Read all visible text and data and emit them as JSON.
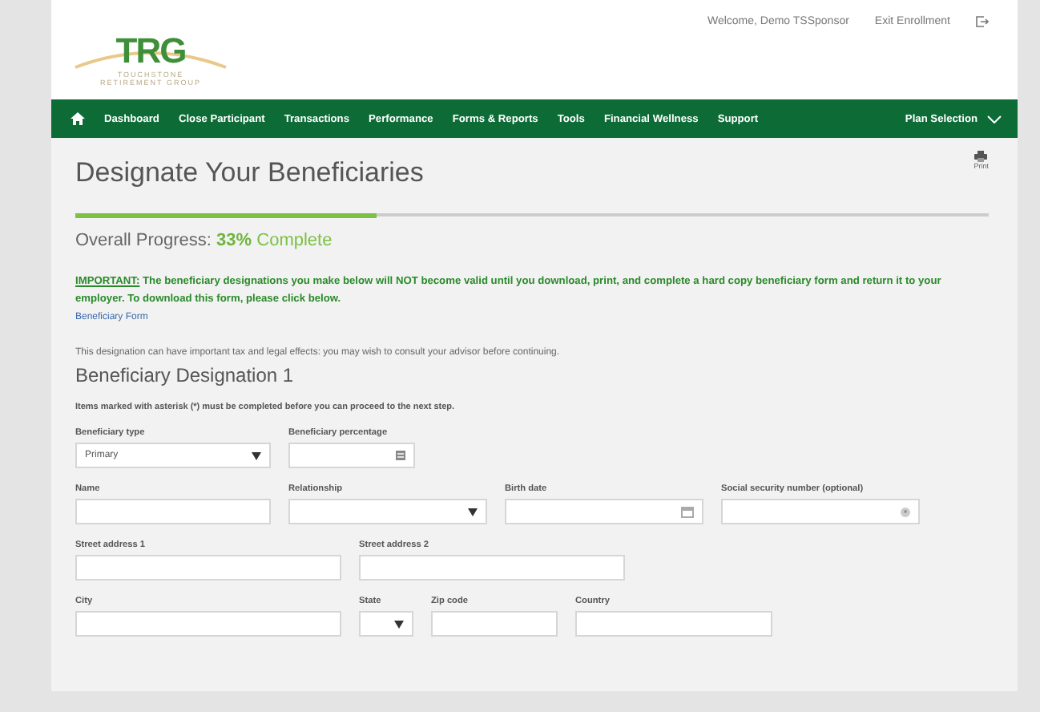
{
  "header": {
    "logo": {
      "letters": "TRG",
      "tagline": "TOUCHSTONE RETIREMENT GROUP"
    },
    "welcome": "Welcome, Demo TSSponsor",
    "exit": "Exit Enrollment"
  },
  "nav": {
    "items": [
      {
        "label": "Dashboard",
        "kind": "home"
      },
      {
        "label": "Close Participant",
        "kind": "link"
      },
      {
        "label": "Transactions",
        "kind": "link"
      },
      {
        "label": "Performance",
        "kind": "link"
      },
      {
        "label": "Forms & Reports",
        "kind": "link"
      },
      {
        "label": "Tools",
        "kind": "link"
      },
      {
        "label": "Financial Wellness",
        "kind": "link"
      },
      {
        "label": "Support",
        "kind": "link"
      }
    ],
    "plan_selection": "Plan Selection"
  },
  "page": {
    "title": "Designate Your Beneficiaries",
    "print": "Print",
    "progress": {
      "level": 0.33,
      "label": "Overall Progress:",
      "percent": "33%",
      "suffix": "Complete"
    },
    "important": {
      "lead": "IMPORTANT:",
      "text": "The beneficiary designations you make below will NOT become valid until you download, print, and complete a hard copy beneficiary form and return it to your employer. To download this form, please click below."
    },
    "form_link": "Beneficiary Form",
    "notice": "This designation can have important tax and legal effects: you may wish to consult your advisor before continuing.",
    "section_title": "Beneficiary Designation 1",
    "required_note": "Items marked with asterisk (*) must be completed before you can proceed to the next step.",
    "rows": [
      [
        {
          "label": "Beneficiary type",
          "kind": "select",
          "value": "Primary"
        },
        {
          "label": "Beneficiary percentage",
          "kind": "number"
        }
      ],
      [
        {
          "label": "Name",
          "kind": "text"
        },
        {
          "label": "Relationship",
          "kind": "select"
        },
        {
          "label": "Birth date",
          "kind": "date"
        },
        {
          "label": "Social security number (optional)",
          "kind": "secure"
        }
      ],
      [
        {
          "label": "Street address 1",
          "kind": "text"
        },
        {
          "label": "Street address 2",
          "kind": "text"
        }
      ],
      [
        {
          "label": "City",
          "kind": "text"
        },
        {
          "label": "State",
          "kind": "select"
        },
        {
          "label": "Zip code",
          "kind": "text"
        },
        {
          "label": "Country",
          "kind": "text"
        }
      ]
    ]
  }
}
